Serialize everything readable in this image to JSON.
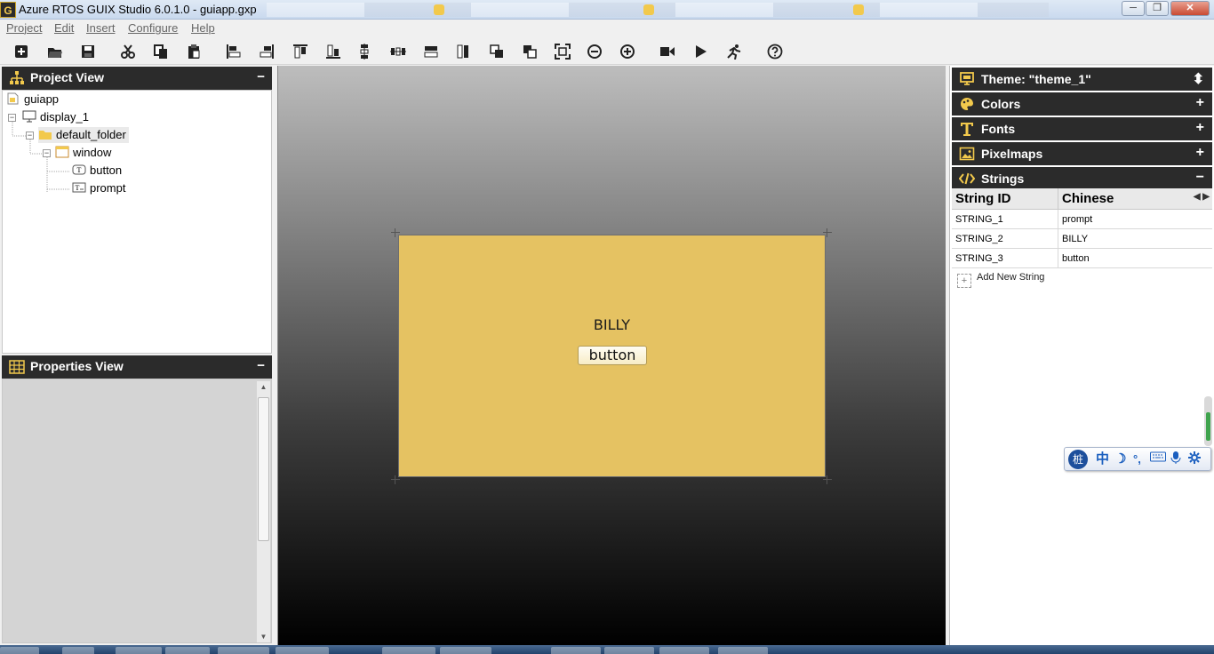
{
  "window": {
    "app_icon_text": "G",
    "title": "Azure RTOS GUIX Studio 6.0.1.0 - guiapp.gxp",
    "minimize_glyph": "─",
    "maximize_glyph": "❐",
    "close_glyph": "✕"
  },
  "menu": {
    "items": [
      {
        "label": "Project"
      },
      {
        "label": "Edit"
      },
      {
        "label": "Insert"
      },
      {
        "label": "Configure"
      },
      {
        "label": "Help"
      }
    ]
  },
  "toolbar": {
    "tools": [
      {
        "icon": "new-project-icon"
      },
      {
        "icon": "open-project-icon"
      },
      {
        "icon": "save-icon"
      },
      {
        "icon": "cut-icon"
      },
      {
        "icon": "copy-icon"
      },
      {
        "icon": "paste-icon"
      },
      {
        "icon": "align-left-icon"
      },
      {
        "icon": "align-right-icon"
      },
      {
        "icon": "align-top-icon"
      },
      {
        "icon": "align-bottom-icon"
      },
      {
        "icon": "vertical-space-icon"
      },
      {
        "icon": "horizontal-space-icon"
      },
      {
        "icon": "equal-width-icon"
      },
      {
        "icon": "equal-height-icon"
      },
      {
        "icon": "move-to-front-icon"
      },
      {
        "icon": "move-to-back-icon"
      },
      {
        "icon": "size-to-fit-icon"
      },
      {
        "icon": "zoom-out-icon"
      },
      {
        "icon": "zoom-in-icon"
      },
      {
        "icon": "record-macro-icon"
      },
      {
        "icon": "playback-macro-icon"
      },
      {
        "icon": "run-application-icon"
      },
      {
        "icon": "help-icon"
      }
    ]
  },
  "project_view": {
    "title": "Project View",
    "collapse_glyph": "−",
    "tree": {
      "root": "guiapp",
      "display": "display_1",
      "folder": "default_folder",
      "window": "window",
      "children": [
        "button",
        "prompt"
      ]
    }
  },
  "properties_view": {
    "title": "Properties View",
    "collapse_glyph": "−"
  },
  "canvas": {
    "background_top": "#bdbdbd",
    "window_color": "#e5c262",
    "prompt_text": "BILLY",
    "button_text": "button"
  },
  "resources": {
    "theme_label": "Theme: \"theme_1\"",
    "sections": [
      {
        "label": "Colors",
        "state": "+"
      },
      {
        "label": "Fonts",
        "state": "+"
      },
      {
        "label": "Pixelmaps",
        "state": "+"
      },
      {
        "label": "Strings",
        "state": "−"
      }
    ],
    "theme_toggle": "⬍",
    "strings_table": {
      "col_id": "String ID",
      "col_lang": "Chinese",
      "nav": "◀ ▶",
      "rows": [
        {
          "id": "STRING_1",
          "text": "prompt"
        },
        {
          "id": "STRING_2",
          "text": "BILLY"
        },
        {
          "id": "STRING_3",
          "text": "button"
        }
      ],
      "add_label": "Add New String",
      "add_glyph": "+"
    }
  },
  "ime": {
    "logo": "桩",
    "items": [
      "中",
      "☽",
      "°,"
    ]
  },
  "colors": {
    "header_bg": "#2b2b2b",
    "accent_icon": "#f2c94c"
  }
}
